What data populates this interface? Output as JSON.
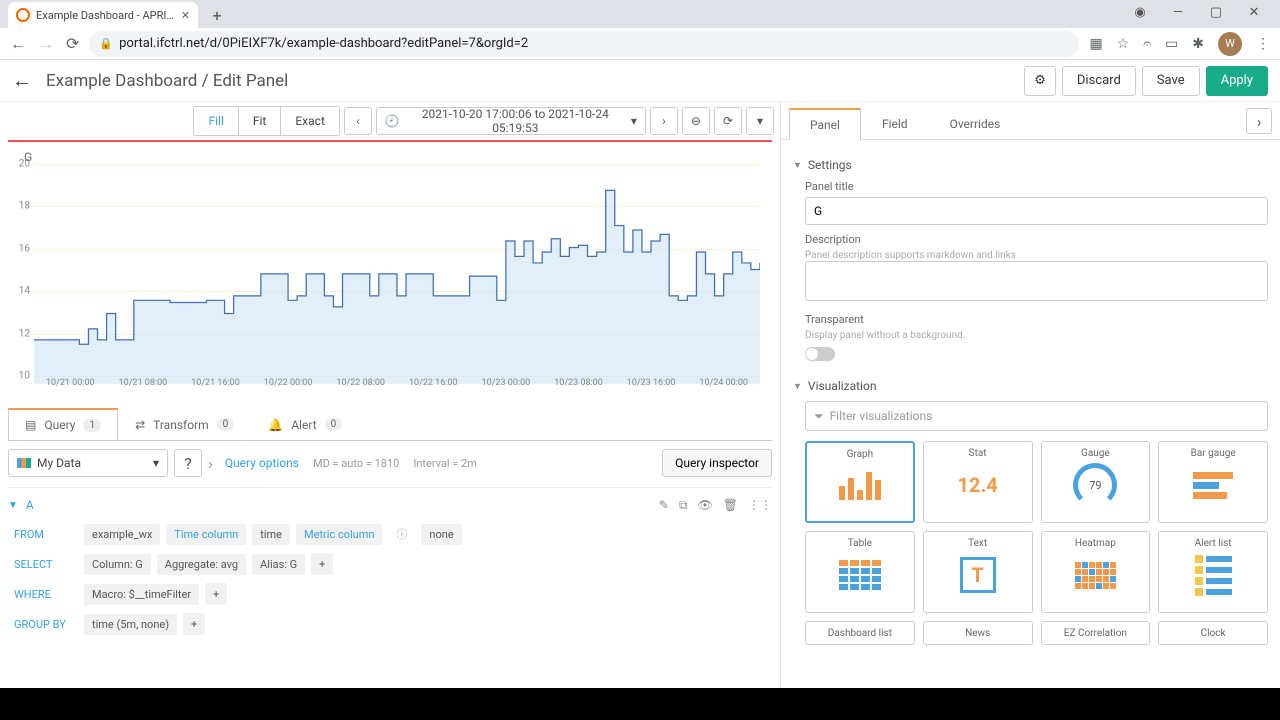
{
  "browser": {
    "tab_title": "Example Dashboard - APRICOT P",
    "url": "portal.ifctrl.net/d/0PiEIXF7k/example-dashboard?editPanel=7&orgId=2",
    "avatar_letter": "W"
  },
  "header": {
    "breadcrumb": "Example Dashboard / Edit Panel",
    "discard": "Discard",
    "save": "Save",
    "apply": "Apply"
  },
  "toolbar": {
    "fill": "Fill",
    "fit": "Fit",
    "exact": "Exact",
    "time_range": "2021-10-20 17:00:06 to 2021-10-24 05:19:53"
  },
  "panel": {
    "title": "G"
  },
  "chart_data": {
    "type": "line",
    "title": "G",
    "ylim": [
      10,
      20
    ],
    "yticks": [
      10,
      12,
      14,
      16,
      18,
      20
    ],
    "xticks": [
      "10/21 00:00",
      "10/21 08:00",
      "10/21 16:00",
      "10/22 00:00",
      "10/22 08:00",
      "10/22 16:00",
      "10/23 00:00",
      "10/23 08:00",
      "10/23 16:00",
      "10/24 00:00"
    ],
    "series": [
      {
        "name": "G",
        "values": [
          12.0,
          12.0,
          12.0,
          12.0,
          12.0,
          11.8,
          12.5,
          12.0,
          13.2,
          12.0,
          12.0,
          13.8,
          13.8,
          13.8,
          13.8,
          13.7,
          13.7,
          13.7,
          13.7,
          13.8,
          13.8,
          13.2,
          14.0,
          14.0,
          14.0,
          15.0,
          15.0,
          15.0,
          13.8,
          14.0,
          15.0,
          15.0,
          14.0,
          13.5,
          15.0,
          15.0,
          15.0,
          14.0,
          15.0,
          15.0,
          14.0,
          15.0,
          15.0,
          15.0,
          14.0,
          14.0,
          14.0,
          14.0,
          14.9,
          14.9,
          14.9,
          13.8,
          16.5,
          15.8,
          16.5,
          15.5,
          16.0,
          16.6,
          15.8,
          16.2,
          16.3,
          15.8,
          16.0,
          18.8,
          17.2,
          16.0,
          17.0,
          16.0,
          16.5,
          16.8,
          14.0,
          13.8,
          14.0,
          16.0,
          15.0,
          14.0,
          15.0,
          16.0,
          15.5,
          15.2,
          15.5
        ]
      }
    ]
  },
  "query_tabs": {
    "query": "Query",
    "query_count": "1",
    "transform": "Transform",
    "transform_count": "0",
    "alert": "Alert",
    "alert_count": "0"
  },
  "query": {
    "datasource": "My Data",
    "options": "Query options",
    "md": "MD = auto = 1810",
    "interval": "Interval = 2m",
    "inspector": "Query inspector",
    "letter": "A",
    "from_kw": "FROM",
    "from_table": "example_wx",
    "time_col_label": "Time column",
    "time_col_value": "time",
    "metric_col_label": "Metric column",
    "metric_col_value": "none",
    "select_kw": "SELECT",
    "select_col": "Column: G",
    "select_agg": "Aggregate: avg",
    "select_alias": "Alias: G",
    "where_kw": "WHERE",
    "where_macro": "Macro: $__timeFilter",
    "groupby_kw": "GROUP BY",
    "groupby_val": "time (5m, none)"
  },
  "side_tabs": {
    "panel": "Panel",
    "field": "Field",
    "overrides": "Overrides"
  },
  "settings": {
    "header": "Settings",
    "title_label": "Panel title",
    "title_value": "G",
    "desc_label": "Description",
    "desc_hint": "Panel description supports markdown and links",
    "transparent_label": "Transparent",
    "transparent_hint": "Display panel without a background."
  },
  "viz": {
    "header": "Visualization",
    "filter_placeholder": "Filter visualizations",
    "items": [
      "Graph",
      "Stat",
      "Gauge",
      "Bar gauge",
      "Table",
      "Text",
      "Heatmap",
      "Alert list",
      "Dashboard list",
      "News",
      "EZ Correlation",
      "Clock"
    ],
    "stat_sample": "12.4",
    "gauge_sample": "79"
  }
}
